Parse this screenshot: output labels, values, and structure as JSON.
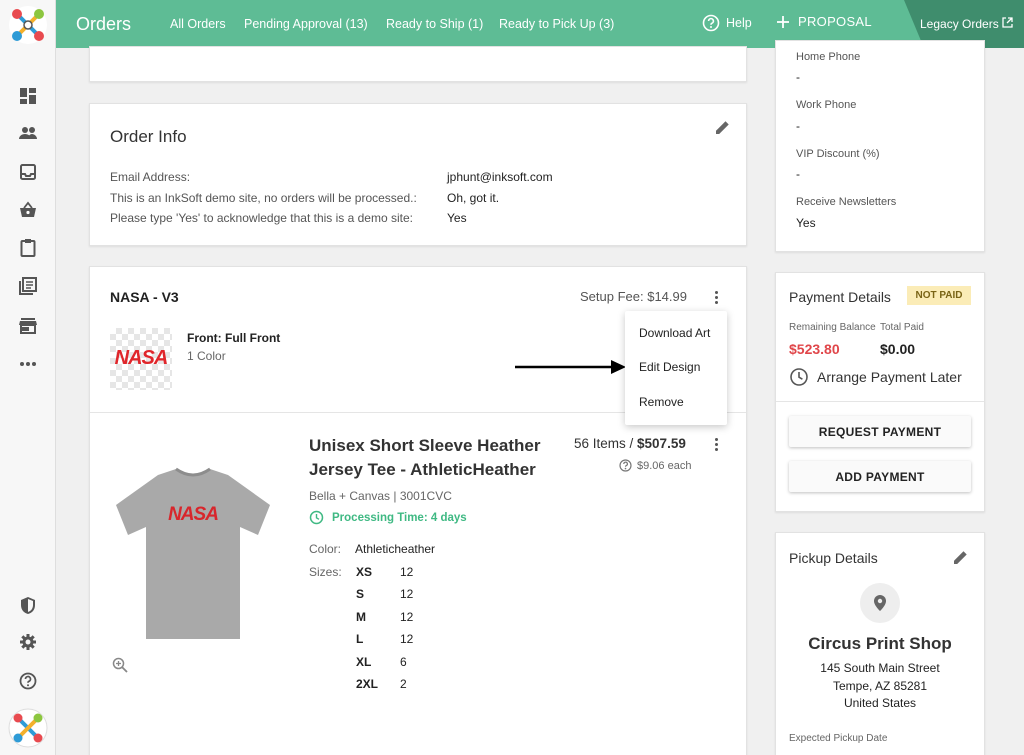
{
  "topbar": {
    "title": "Orders",
    "nav": [
      "All Orders",
      "Pending Approval (13)",
      "Ready to Ship (1)",
      "Ready to Pick Up (3)"
    ],
    "help": "Help",
    "proposal": "PROPOSAL",
    "legacy": "Legacy Orders",
    "bg_color": "#5ebc95"
  },
  "rail": {
    "icons": [
      "dashboard-icon",
      "people-icon",
      "inbox-icon",
      "basket-icon",
      "clipboard-icon",
      "library-icon",
      "store-icon",
      "more-icon",
      "shield-icon",
      "gear-icon",
      "help-icon"
    ]
  },
  "order_info": {
    "title": "Order Info",
    "rows": [
      {
        "label": "Email Address:",
        "value": "jphunt@inksoft.com"
      },
      {
        "label": "This is an InkSoft demo site, no orders will be processed.:",
        "value": "Oh, got it."
      },
      {
        "label": "Please type 'Yes' to acknowledge that this is a demo site:",
        "value": "Yes"
      }
    ]
  },
  "design": {
    "name": "NASA - V3",
    "setup_fee": "Setup Fee: $14.99",
    "location": "Front: Full Front",
    "colors": "1 Color",
    "art_text": "NASA",
    "menu": [
      "Download Art",
      "Edit Design",
      "Remove"
    ]
  },
  "product": {
    "title_line1": "Unisex Short Sleeve Heather",
    "title_line2": "Jersey Tee - AthleticHeather",
    "brand": "Bella + Canvas | 3001CVC",
    "processing": "Processing Time: 4 days",
    "items": "56 Items / ",
    "total": "$507.59",
    "each": "$9.06 each",
    "color_label": "Color:",
    "color_value": "Athleticheather",
    "sizes_label": "Sizes:",
    "sizes": [
      {
        "size": "XS",
        "qty": "12"
      },
      {
        "size": "S",
        "qty": "12"
      },
      {
        "size": "M",
        "qty": "12"
      },
      {
        "size": "L",
        "qty": "12"
      },
      {
        "size": "XL",
        "qty": "6"
      },
      {
        "size": "2XL",
        "qty": "2"
      }
    ],
    "shirt_text": "NASA"
  },
  "customer": {
    "home_phone_label": "Home Phone",
    "home_phone": "-",
    "work_phone_label": "Work Phone",
    "work_phone": "-",
    "vip_label": "VIP Discount (%)",
    "vip": "-",
    "newsletters_label": "Receive Newsletters",
    "newsletters": "Yes"
  },
  "payment": {
    "title": "Payment Details",
    "status": "NOT PAID",
    "remaining_label": "Remaining Balance",
    "remaining": "$523.80",
    "paid_label": "Total Paid",
    "paid": "$0.00",
    "arrange": "Arrange Payment Later",
    "request_btn": "REQUEST PAYMENT",
    "add_btn": "ADD PAYMENT",
    "remaining_color": "#e0464a"
  },
  "pickup": {
    "title": "Pickup Details",
    "shop": "Circus Print Shop",
    "street": "145 South Main Street",
    "city": "Tempe, AZ 85281",
    "country": "United States",
    "expected_label": "Expected Pickup Date"
  }
}
